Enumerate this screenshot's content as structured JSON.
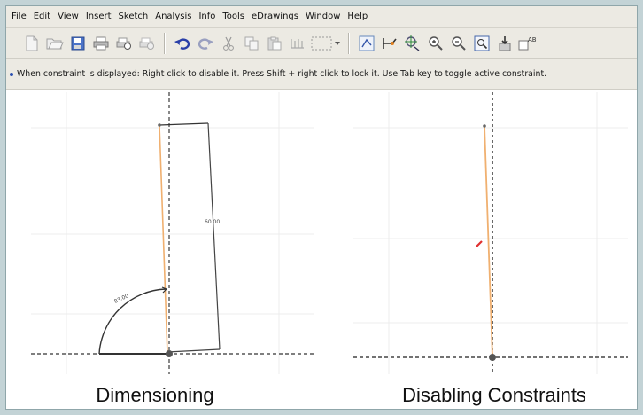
{
  "menu": {
    "items": [
      "File",
      "Edit",
      "View",
      "Insert",
      "Sketch",
      "Analysis",
      "Info",
      "Tools",
      "eDrawings",
      "Window",
      "Help"
    ]
  },
  "toolbar": {
    "buttons": [
      "new-icon",
      "open-icon",
      "save-icon",
      "print-icon",
      "print-preview-icon",
      "page-setup-icon",
      "undo-icon",
      "redo-icon",
      "cut-icon",
      "copy-icon",
      "paste-icon",
      "dimension-icon",
      "select-combo-icon",
      "sketch-icon",
      "constraint-icon",
      "axis-icon",
      "zoom-in-icon",
      "zoom-out-icon",
      "zoom-window-icon",
      "insert-icon",
      "text-icon"
    ],
    "text_button_label": "AB"
  },
  "hint": {
    "text": "When constraint is displayed: Right click to disable it. Press Shift + right click to lock it. Use Tab key to toggle active constraint."
  },
  "panels": {
    "left": {
      "caption": "Dimensioning",
      "dimension_vertical": "60.00",
      "dimension_angle": "83.00"
    },
    "right": {
      "caption": "Disabling Constraints"
    }
  },
  "colors": {
    "sketch_line": "#f0b070",
    "construction": "#555555",
    "constraint_marker": "#e03030",
    "background": "#c3d3d6"
  }
}
